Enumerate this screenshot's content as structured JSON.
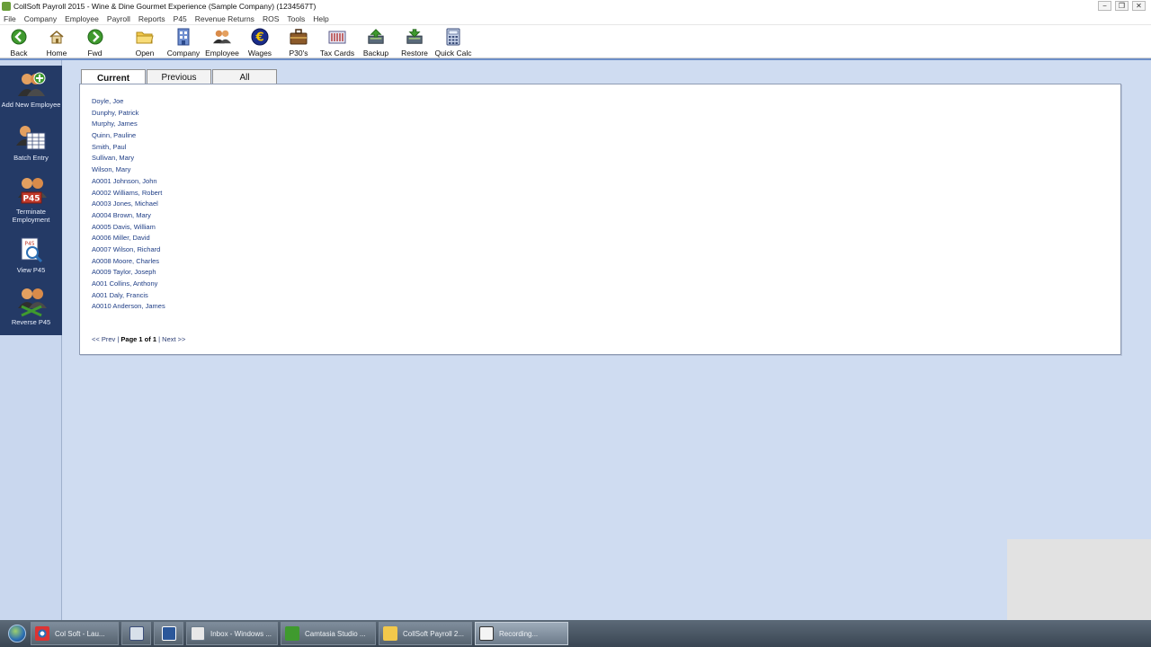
{
  "window": {
    "title": "CollSoft Payroll 2015 - Wine & Dine Gourmet Experience (Sample Company) (1234567T)",
    "controls": [
      "−",
      "❐",
      "✕"
    ]
  },
  "menu": [
    "File",
    "Company",
    "Employee",
    "Payroll",
    "Reports",
    "P45",
    "Revenue Returns",
    "ROS",
    "Tools",
    "Help"
  ],
  "toolbar": {
    "back": "Back",
    "home": "Home",
    "fwd": "Fwd",
    "open": "Open",
    "company": "Company",
    "employee": "Employee",
    "wages": "Wages",
    "p30s": "P30's",
    "tax_cards": "Tax Cards",
    "backup": "Backup",
    "restore": "Restore",
    "quick_calc": "Quick Calc",
    "wages_symbol": "€"
  },
  "sidebar": {
    "add_new_employee": "Add New Employee",
    "batch_entry": "Batch Entry",
    "terminate_employment": "Terminate Employment",
    "terminate_badge": "P45",
    "view_p45": "View P45",
    "view_badge": "P45",
    "reverse_p45": "Reverse P45"
  },
  "tabs": [
    "Current",
    "Previous",
    "All"
  ],
  "employees": [
    "Doyle, Joe",
    "Dunphy, Patrick",
    "Murphy, James",
    "Quinn, Pauline",
    "Smith, Paul",
    "Sullivan, Mary",
    "Wilson, Mary",
    "A0001 Johnson, John",
    "A0002 Williams, Robert",
    "A0003 Jones, Michael",
    "A0004 Brown, Mary",
    "A0005 Davis, William",
    "A0006 Miller, David",
    "A0007 Wilson, Richard",
    "A0008 Moore, Charles",
    "A0009 Taylor, Joseph",
    "A001 Collins, Anthony",
    "A001 Daly, Francis",
    "A0010 Anderson, James"
  ],
  "pager": {
    "prev": "<< Prev",
    "sep": "|",
    "current": "Page 1 of 1",
    "next": "Next >>"
  },
  "taskbar": [
    "Col Soft - Lau...",
    "Inbox - Windows ...",
    "Camtasia Studio ...",
    "CollSoft Payroll 2...",
    "Recording..."
  ]
}
